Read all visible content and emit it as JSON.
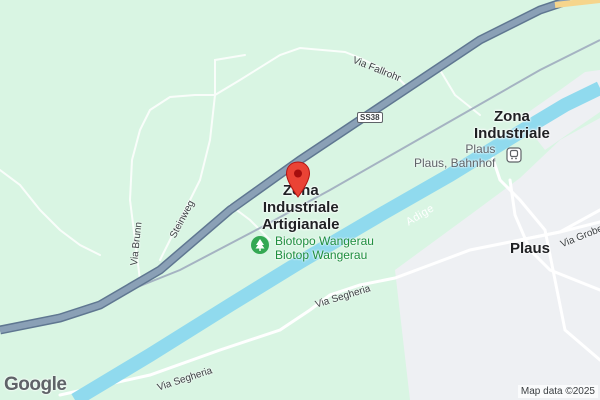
{
  "map": {
    "places": {
      "zona_artigianale": [
        "Zona",
        "Industriale",
        "Artigianale"
      ],
      "zona_industriale": [
        "Zona",
        "Industriale"
      ],
      "plaus": "Plaus"
    },
    "poi": {
      "biotope_it": "Biotopo Wangerau",
      "biotope_de": "Biotop Wangerau",
      "station_line1": "Plaus",
      "station_line2": "Plaus, Bahnhof"
    },
    "roads": {
      "highway_shield": "SS38",
      "via_fallrohr": "Via Fallrohr",
      "steinweg": "Steinweg",
      "via_brunn": "Via Brunn",
      "via_segheria_1": "Via Segheria",
      "via_segheria_2": "Via Segheria",
      "via_grobe": "Via Grobe"
    },
    "river": "Adige",
    "logo": "Google",
    "attribution": "Map data ©2025"
  },
  "colors": {
    "land": "#d9f5e3",
    "urban": "#eef0f3",
    "river": "#90daee",
    "highway": "#7f96ad",
    "road": "#ffffff",
    "pin": "#ea4335"
  }
}
